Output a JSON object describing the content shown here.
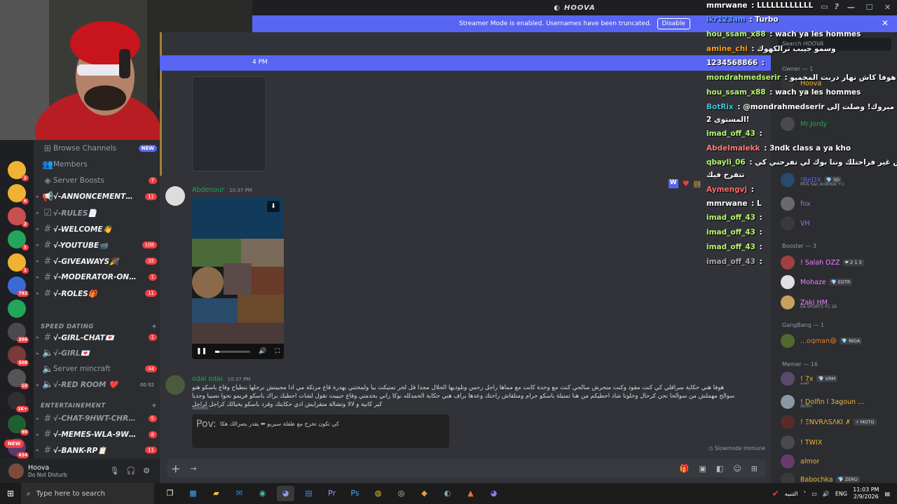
{
  "app": {
    "title": "HOOVA"
  },
  "banner": {
    "text": "Streamer Mode is enabled. Usernames have been truncated.",
    "button": "Disable"
  },
  "sidebar": {
    "items": [
      {
        "label": "Browse Channels",
        "badge": "NEW",
        "kind": "plain",
        "icon": "compass-icon"
      },
      {
        "label": "Members",
        "badge": "",
        "kind": "plain",
        "icon": "members-icon"
      },
      {
        "label": "Server Boosts",
        "badge": "7",
        "kind": "plain",
        "icon": "boost-icon"
      },
      {
        "label": "√-ANNONCEMENT…",
        "badge": "11",
        "kind": "italic",
        "icon": "megaphone-icon"
      },
      {
        "label": "√-RULES📄",
        "badge": "",
        "kind": "italic-muted",
        "icon": "rules-icon"
      },
      {
        "label": "√-WELCOME👋",
        "badge": "",
        "kind": "italic",
        "icon": "hash-icon"
      },
      {
        "label": "√-YOUTUBE📹",
        "badge": "108",
        "kind": "italic",
        "icon": "hash-icon"
      },
      {
        "label": "√-GIVEAWAYS🎉",
        "badge": "35",
        "kind": "italic",
        "icon": "hash-icon"
      },
      {
        "label": "√-MODERATOR-ON…",
        "badge": "1",
        "kind": "italic",
        "icon": "hash-icon"
      },
      {
        "label": "√-ROLES🎁",
        "badge": "11",
        "kind": "italic",
        "icon": "hash-icon"
      }
    ],
    "category_speed": "SPEED DATING",
    "speed_items": [
      {
        "label": "√-GIRL-CHAT💌",
        "badge": "1",
        "kind": "italic",
        "icon": "hash-icon"
      },
      {
        "label": "√-GIRL💌",
        "badge": "",
        "kind": "italic-muted",
        "icon": "speaker-icon"
      },
      {
        "label": "Server mincraft",
        "badge": "44",
        "kind": "plain",
        "icon": "speaker-icon"
      },
      {
        "label": "√-RED ROOM ❤️",
        "badge": "00 02",
        "kind": "italic-muted",
        "icon": "speaker-icon"
      }
    ],
    "category_ent": "ENTERTAINEMENT",
    "ent_items": [
      {
        "label": "√-CHAT-9HWT-CHR…",
        "badge": "5",
        "kind": "italic-muted",
        "icon": "hash-icon"
      },
      {
        "label": "√-MEMES-WLA-9W…",
        "badge": "8",
        "kind": "italic",
        "icon": "hash-icon"
      },
      {
        "label": "√-BANK-RP📋",
        "badge": "11",
        "kind": "italic",
        "icon": "hash-icon"
      }
    ]
  },
  "servers": [
    {
      "color": "#f0b232",
      "badge": "2"
    },
    {
      "color": "#f0b232",
      "badge": "6"
    },
    {
      "color": "#c94f4f",
      "badge": "2"
    },
    {
      "color": "#23a55a",
      "badge": "1"
    },
    {
      "color": "#f0b232",
      "badge": "1"
    },
    {
      "color": "#3a6ad6",
      "badge": "792"
    },
    {
      "color": "#23a55a",
      "badge": ""
    },
    {
      "color": "#4a4a4a",
      "badge": "396"
    },
    {
      "color": "#7a3a3a",
      "badge": "508"
    },
    {
      "color": "#555",
      "badge": "10"
    },
    {
      "color": "#303030",
      "badge": "1K+"
    },
    {
      "color": "#206030",
      "badge": "90"
    },
    {
      "color": "#5a3a6a",
      "badge": "434"
    }
  ],
  "server_new": "NEW",
  "user": {
    "name": "Hoova",
    "status": "Do Not Disturb"
  },
  "chat": {
    "top_time": "4 PM",
    "messages": [
      {
        "author": "Abdenour",
        "time": "10:37 PM",
        "color": "#23a55a"
      },
      {
        "author": "odai odai",
        "time": "10:37 PM",
        "color": "#23a55a",
        "text": "هوفا هني حكاية سراقلي كي كنت مقود وكنت منحرش سالحي كنت مع وحدة كانت مع مماها راجل رحس وتلوديها الحلال مجدا قل لخر تمتيكت بيا ولمختني بهدرة قاع مرتكة مي ادا محبيتش نرجلها بتطياح وقاع باسكو هنو سوالح مهملش من سوالحا نحن كرحال وخلونا شاد احطيكم من هنا تمتيلة باسكو حرام ومتلقاش راحتك وعدها براف هني حكاية الحمدلله نوكا راني بخدمتي وقاع حبيبت تقول لشات احطيك براك باسكو فريمو نحوا نصيبا وجديا كير كانية و لالا وتشالة متقرايش ادي حكايتك وقرد باسكو يخيالك كراجل لراجل",
        "edited": "(edited)",
        "embed_title": "Pov:",
        "embed_text": "كي تكون تخرج مع طفلة سيريو ⬅ يقدر يصرالك هكا"
      }
    ],
    "slowmode": "Slowmode Immune"
  },
  "members": {
    "search": "Search HOOVA",
    "groups": [
      {
        "label": "Owner — 1"
      },
      {
        "label": "Booster — 3"
      },
      {
        "label": "GangBang — 1"
      },
      {
        "label": "Memer — 16"
      }
    ],
    "list": [
      {
        "name": "Hoova",
        "color": "#f0b232",
        "tag": "",
        "sub": ""
      },
      {
        "name": "Mr.Jordy",
        "color": "#23a55a",
        "tag": "",
        "sub": ""
      },
      {
        "name": "!ReDX",
        "color": "#5865f2",
        "tag": "💎 3D",
        "sub": "MTA San Andreas +1"
      },
      {
        "name": "fox",
        "color": "#a074d9",
        "tag": "",
        "sub": ""
      },
      {
        "name": "VH",
        "color": "#a074d9",
        "tag": "",
        "sub": ""
      },
      {
        "name": "! Salah DZZ",
        "color": "#f47fff",
        "tag": "❤ 2 1 3",
        "sub": ""
      },
      {
        "name": "Mohaze",
        "color": "#f47fff",
        "tag": "💎 EDTR",
        "sub": ""
      },
      {
        "name": "Zaki HM",
        "color": "#f47fff",
        "tag": "",
        "sub": "EA SPORTS FC 26"
      },
      {
        "name": "...oqman😄",
        "color": "#e67e22",
        "tag": "💎 NIGA",
        "sub": ""
      },
      {
        "name": "! 7x",
        "color": "#f0b232",
        "tag": "💎 VRM",
        "sub": "الحنة"
      },
      {
        "name": "! Dolfin l 3agoun ...",
        "color": "#f0b232",
        "tag": "",
        "sub": "dolfin"
      },
      {
        "name": "! ΞΝVRΛSΛΚΙ ✗",
        "color": "#f0b232",
        "tag": "⚡ MOTO",
        "sub": ""
      },
      {
        "name": "! TWIX",
        "color": "#f0b232",
        "tag": "",
        "sub": ""
      },
      {
        "name": "almor",
        "color": "#f0b232",
        "tag": "",
        "sub": ""
      },
      {
        "name": "Babochka",
        "color": "#f0b232",
        "tag": "💎 ZERO",
        "sub": ""
      }
    ]
  },
  "stream_chat": [
    {
      "user": "mmrwane",
      "msg": "LLLLLLLLLLLL",
      "color": "#ffffff"
    },
    {
      "user": "ikr123am",
      "msg": "Turbo",
      "color": "#5c9dff"
    },
    {
      "user": "hou_ssam_x88",
      "msg": "wach ya les hommes",
      "color": "#b6f76d"
    },
    {
      "user": "amine_chi",
      "msg": "وسمو جيبب ترالكهوك",
      "color": "#ff9f1c"
    },
    {
      "user": "1234568866",
      "msg": "",
      "color": "#ffffff"
    },
    {
      "user": "mondrahmedserir",
      "msg": "هوفا كاش نهار دربت المخميو",
      "color": "#b6f76d"
    },
    {
      "user": "hou_ssam_x88",
      "msg": "wach ya les hommes",
      "color": "#b6f76d"
    },
    {
      "user": "BotRix",
      "msg": "@mondrahmedserir مبروك! وصلت إلى",
      "color": "#3ec1d3"
    },
    {
      "user": "",
      "msg": "المستوى 2!",
      "color": "#ffffff"
    },
    {
      "user": "imad_off_43",
      "msg": "",
      "color": "#b6f76d"
    },
    {
      "user": "Abdelmalekk",
      "msg": "3ndk class a ya kho",
      "color": "#ff7b7b"
    },
    {
      "user": "qbayli_06",
      "msg": "هوفا شد هيبارك وش غير فراحتلك وننا بوك لي تفرحني كي",
      "color": "#b6f76d"
    },
    {
      "user": "",
      "msg": "تتفرح فيك",
      "color": "#ffffff"
    },
    {
      "user": "Aymengvj",
      "msg": "",
      "color": "#ff6b6b"
    },
    {
      "user": "mmrwane",
      "msg": "L",
      "color": "#ffffff"
    },
    {
      "user": "imad_off_43",
      "msg": "",
      "color": "#b6f76d"
    },
    {
      "user": "imad_off_43",
      "msg": "",
      "color": "#b6f76d"
    },
    {
      "user": "imad_off_43",
      "msg": "",
      "color": "#b6f76d"
    },
    {
      "user": "imad_off_43",
      "msg": "",
      "color": "#aaaaaa"
    }
  ],
  "taskbar": {
    "search": "Type here to search",
    "lang": "ENG",
    "time": "11:03 PM",
    "date": "2/9/2026",
    "weather": "التنبيه"
  }
}
